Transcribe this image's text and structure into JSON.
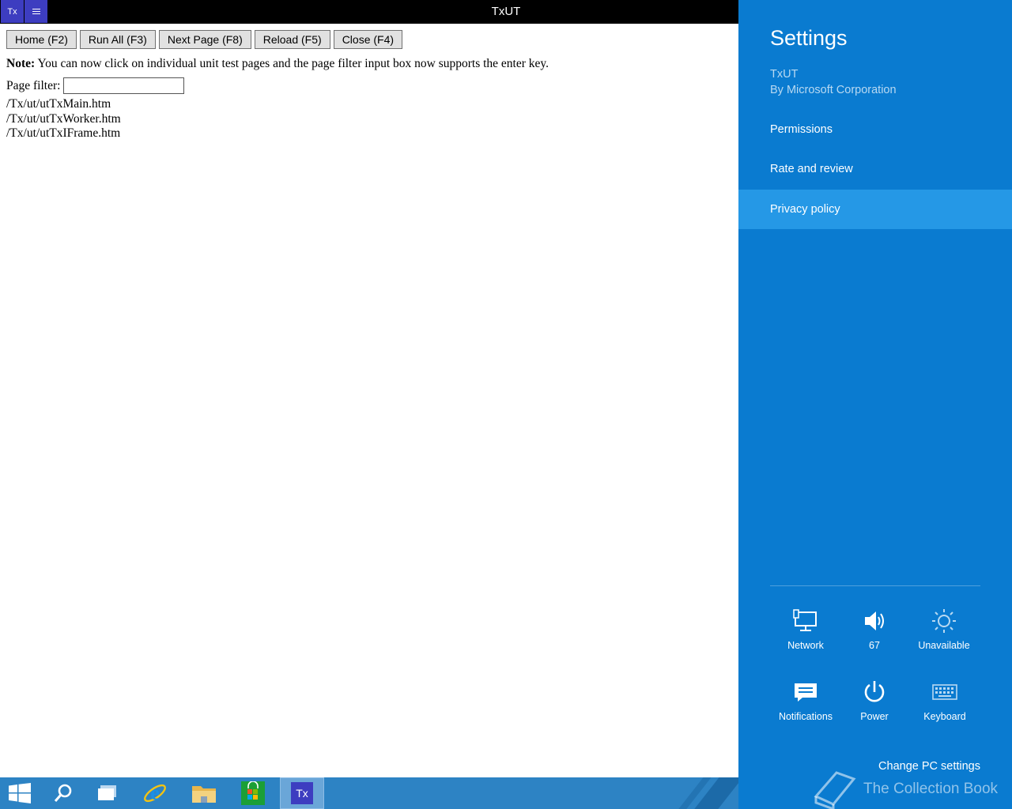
{
  "window": {
    "app_icon_text": "Tx",
    "title": "TxUT"
  },
  "toolbar": {
    "buttons": [
      {
        "label": "Home (F2)"
      },
      {
        "label": "Run All (F3)"
      },
      {
        "label": "Next Page (F8)"
      },
      {
        "label": "Reload (F5)"
      },
      {
        "label": "Close (F4)"
      }
    ]
  },
  "note": {
    "prefix": "Note:",
    "text": " You can now click on individual unit test pages and the page filter input box now supports the enter key."
  },
  "filter": {
    "label": "Page filter:",
    "value": ""
  },
  "pages": [
    "/Tx/ut/utTxMain.htm",
    "/Tx/ut/utTxWorker.htm",
    "/Tx/ut/utTxIFrame.htm"
  ],
  "taskbar": {
    "items": [
      "start-icon",
      "search-icon",
      "task-view-icon",
      "internet-explorer-icon",
      "file-explorer-icon",
      "store-icon",
      "txut-app-icon"
    ],
    "txut_label": "Tx"
  },
  "settings": {
    "title": "Settings",
    "app_name": "TxUT",
    "publisher": "By Microsoft Corporation",
    "menu": {
      "permissions": "Permissions",
      "rate": "Rate and review",
      "privacy": "Privacy policy"
    },
    "quick": {
      "network": "Network",
      "volume": "67",
      "brightness": "Unavailable",
      "notifications": "Notifications",
      "power": "Power",
      "keyboard": "Keyboard"
    },
    "change_pc_settings": "Change PC settings",
    "watermark": "The Collection Book"
  },
  "colors": {
    "charm_bg": "#0a7bd0",
    "charm_selected": "#2598e6",
    "taskbar": "#2d83c4",
    "app_icon": "#3d3dc0"
  }
}
